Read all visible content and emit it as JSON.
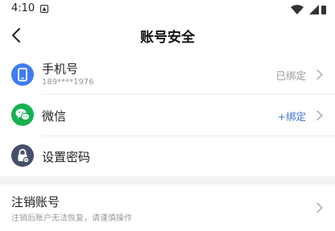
{
  "status_bar": {
    "time": "4:10",
    "icons": [
      "app-notification-icon",
      "wifi-icon",
      "signal-icon"
    ]
  },
  "header": {
    "title": "账号安全"
  },
  "items": [
    {
      "label": "手机号",
      "sub": "189****1976",
      "status": "已绑定",
      "icon": "phone-icon"
    },
    {
      "label": "微信",
      "status": "+绑定",
      "icon": "wechat-icon"
    },
    {
      "label": "设置密码",
      "icon": "lock-icon"
    }
  ],
  "cancel": {
    "label": "注销账号",
    "sub": "注销后账户无法恢复，请谨慎操作"
  },
  "colors": {
    "phone_icon_bg": "#3f7cf0",
    "wechat_icon_bg": "#16b150",
    "lock_icon_bg": "#46506a",
    "bind_link": "#3b74d6",
    "muted_text": "#9a9a9a"
  }
}
